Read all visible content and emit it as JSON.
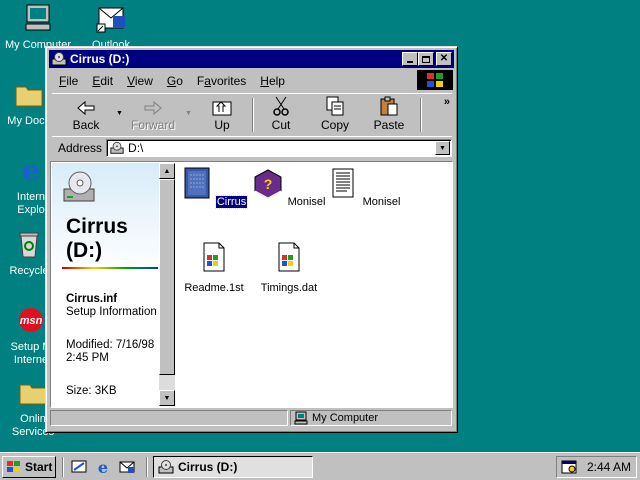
{
  "desktop": {
    "icons": [
      {
        "label": "My Computer",
        "icon": "computer-icon"
      },
      {
        "label": "Outlook",
        "icon": "outlook-icon"
      },
      {
        "label": "My Docu",
        "icon": "folder-icon"
      },
      {
        "label": "Intern",
        "label2": "Explo",
        "icon": "ie-icon"
      },
      {
        "label": "Recycle",
        "icon": "recycle-bin-icon"
      },
      {
        "label": "Setup M",
        "label2": "Interne",
        "icon": "msn-icon"
      },
      {
        "label": "Onlin",
        "label2": "Services",
        "icon": "folder-icon"
      }
    ]
  },
  "window": {
    "title": "Cirrus (D:)",
    "menu": [
      "File",
      "Edit",
      "View",
      "Go",
      "Favorites",
      "Help"
    ],
    "menu_underline": [
      "F",
      "E",
      "V",
      "G",
      "a",
      "H"
    ],
    "toolbar": {
      "back": "Back",
      "forward": "Forward",
      "up": "Up",
      "cut": "Cut",
      "copy": "Copy",
      "paste": "Paste",
      "more": "»"
    },
    "address": {
      "label": "Address",
      "value": "D:\\"
    },
    "webview": {
      "title_line1": "Cirrus",
      "title_line2": "(D:)",
      "file_name": "Cirrus.inf",
      "file_type": "Setup Information",
      "modified": "Modified: 7/16/98 2:45 PM",
      "size": "Size: 3KB"
    },
    "files": [
      {
        "label": "Cirrus",
        "icon": "inf-file-icon",
        "selected": true
      },
      {
        "label": "Monisel",
        "icon": "help-book-icon"
      },
      {
        "label": "Monisel",
        "icon": "text-document-icon"
      },
      {
        "label": "Readme.1st",
        "icon": "unknown-file-icon"
      },
      {
        "label": "Timings.dat",
        "icon": "unknown-file-icon"
      }
    ],
    "status": {
      "zone": "My Computer"
    }
  },
  "taskbar": {
    "start": "Start",
    "task": "Cirrus (D:)",
    "clock": "2:44 AM"
  }
}
